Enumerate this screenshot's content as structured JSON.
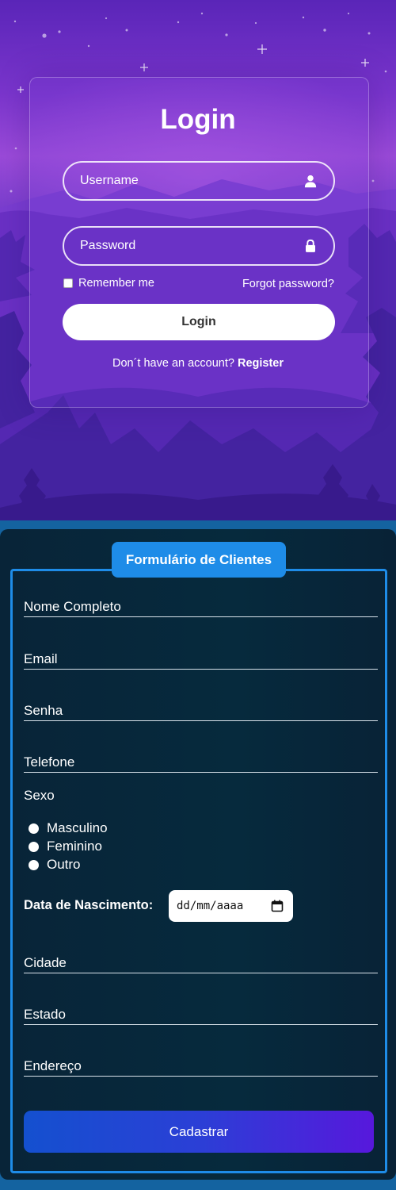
{
  "login": {
    "title": "Login",
    "username_placeholder": "Username",
    "password_placeholder": "Password",
    "remember_label": "Remember me",
    "remember_checked": false,
    "forgot_label": "Forgot password?",
    "submit_label": "Login",
    "no_account_text": "Don´t have an account?",
    "register_label": "Register"
  },
  "client_form": {
    "legend": "Formulário de Clientes",
    "fields": {
      "full_name": "Nome Completo",
      "email": "Email",
      "password": "Senha",
      "phone": "Telefone",
      "city": "Cidade",
      "state": "Estado",
      "address": "Endereço"
    },
    "sex_label": "Sexo",
    "sex_options": [
      "Masculino",
      "Feminino",
      "Outro"
    ],
    "birth_label": "Data de Nascimento:",
    "birth_placeholder": "dd/mm/aaaa",
    "submit_label": "Cadastrar"
  },
  "colors": {
    "login_card_border": "#ffffff",
    "form_accent": "#1e8ce8",
    "form_panel": "#072639",
    "submit_gradient_start": "#1450cf",
    "submit_gradient_end": "#5718dc"
  },
  "icons": {
    "username": "user-icon",
    "password": "lock-icon",
    "date": "calendar-icon"
  }
}
